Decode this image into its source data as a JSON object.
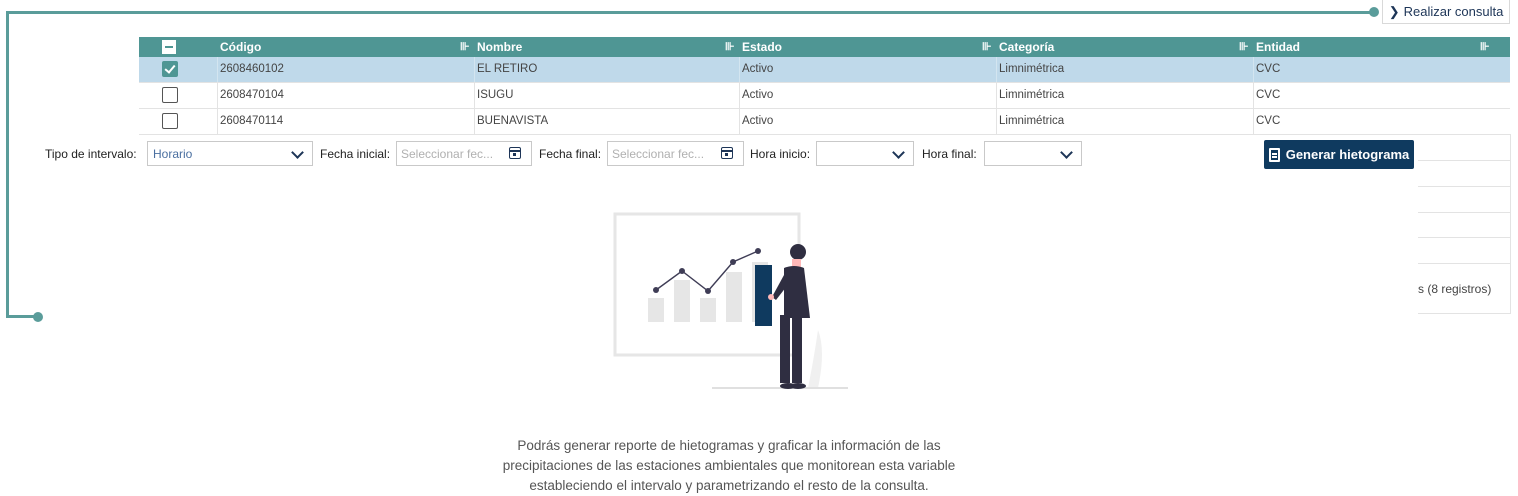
{
  "toolbar": {
    "consult_label": "Realizar consulta"
  },
  "table": {
    "columns": [
      "Código",
      "Nombre",
      "Estado",
      "Categoría",
      "Entidad"
    ],
    "rows": [
      {
        "codigo": "2608460102",
        "nombre": "EL RETIRO",
        "estado": "Activo",
        "categoria": "Limnimétrica",
        "entidad": "CVC",
        "selected": true
      },
      {
        "codigo": "2608470104",
        "nombre": "ISUGU",
        "estado": "Activo",
        "categoria": "Limnimétrica",
        "entidad": "CVC",
        "selected": false
      },
      {
        "codigo": "2608470114",
        "nombre": "BUENAVISTA",
        "estado": "Activo",
        "categoria": "Limnimétrica",
        "entidad": "CVC",
        "selected": false
      }
    ],
    "footer_partial": "s (8 registros)"
  },
  "filters": {
    "interval_label": "Tipo de intervalo:",
    "interval_value": "Horario",
    "start_date_label": "Fecha inicial:",
    "start_date_placeholder": "Seleccionar fec...",
    "end_date_label": "Fecha final:",
    "end_date_placeholder": "Seleccionar fec...",
    "start_hour_label": "Hora inicio:",
    "end_hour_label": "Hora final:"
  },
  "actions": {
    "generate_label": "Generar hietograma"
  },
  "empty_state": {
    "line1": "Podrás generar reporte de hietogramas y graficar la información de las",
    "line2": "precipitaciones de las estaciones ambientales que monitorean esta variable",
    "line3": "estableciendo el intervalo y parametrizando el resto de la consulta."
  },
  "colors": {
    "header": "#4f9694",
    "selected_row": "#bfd9ea",
    "primary": "#0f3a5f",
    "accent": "#5a9c9a"
  }
}
